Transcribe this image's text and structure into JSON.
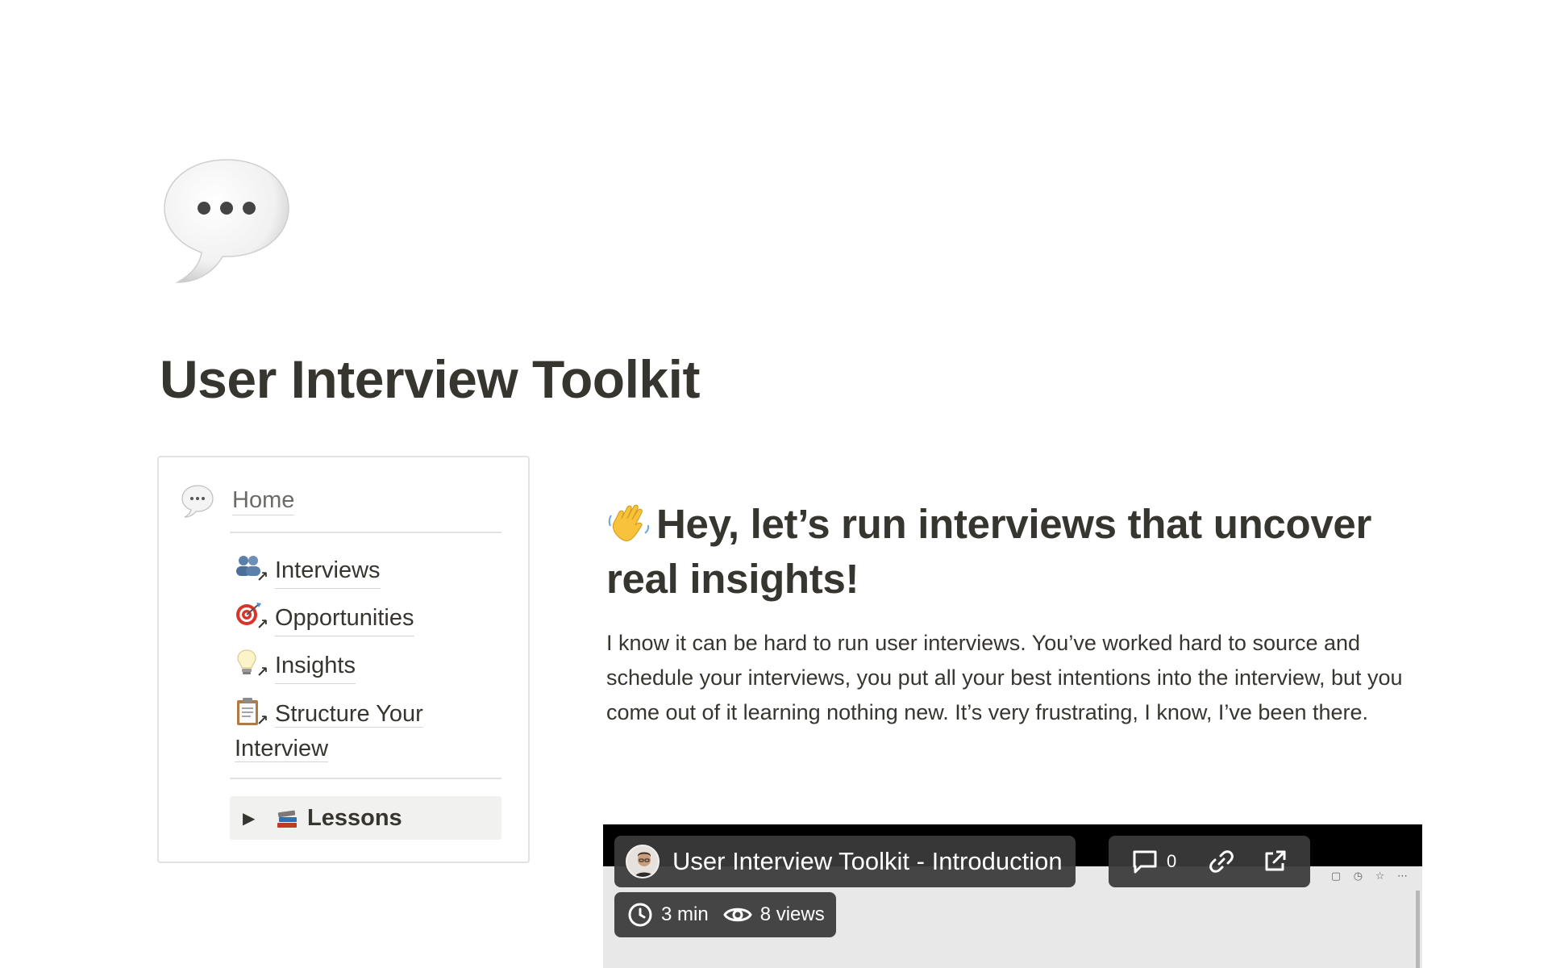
{
  "page": {
    "icon": "speech-bubble-icon",
    "title": "User Interview Toolkit"
  },
  "nav": {
    "home_label": "Home",
    "items": [
      {
        "label": "Interviews",
        "icon": "people-icon"
      },
      {
        "label": "Opportunities",
        "icon": "target-icon"
      },
      {
        "label": "Insights",
        "icon": "lightbulb-icon"
      },
      {
        "label": "Structure Your Interview",
        "icon": "clipboard-icon"
      }
    ],
    "toggle": {
      "label": "Lessons",
      "icon": "books-icon"
    }
  },
  "content": {
    "heading": "Hey, let’s run interviews that uncover real insights!",
    "paragraph": "I know it can be hard to run user interviews. You’ve worked hard to source and schedule your interviews, you put all your best intentions into the interview, but you come out of it learning nothing new. It’s very frustrating, I know, I’ve been there."
  },
  "video": {
    "title": "User Interview Toolkit - Introduction",
    "comment_count": "0",
    "duration": "3 min",
    "views": "8 views"
  }
}
